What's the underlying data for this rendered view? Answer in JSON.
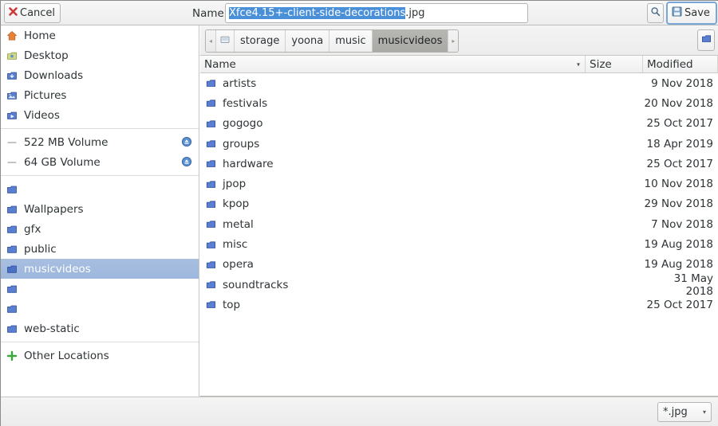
{
  "dialog": {
    "cancel_label": "Cancel",
    "save_label": "Save",
    "name_label": "Name",
    "filename_selected": "Xfce4.15+-client-side-decorations",
    "filename_extension": ".jpg",
    "filename_full": "Xfce4.15+-client-side-decorations.jpg",
    "search_icon": "search-icon",
    "cancel_icon": "cancel-x-icon",
    "save_icon": "floppy-disk-icon",
    "new_folder_icon": "new-folder-icon",
    "accent_selection": "#4a90d9",
    "accent_row_selected": "#a0b8e0"
  },
  "sidebar": {
    "groups": [
      {
        "items": [
          {
            "label": "Home",
            "icon": "home-icon",
            "selected": false
          },
          {
            "label": "Desktop",
            "icon": "desktop-icon",
            "selected": false
          },
          {
            "label": "Downloads",
            "icon": "downloads-icon",
            "selected": false
          },
          {
            "label": "Pictures",
            "icon": "pictures-icon",
            "selected": false
          },
          {
            "label": "Videos",
            "icon": "videos-icon",
            "selected": false
          }
        ]
      },
      {
        "items": [
          {
            "label": "522 MB Volume",
            "icon": "drive-icon",
            "eject": true,
            "selected": false
          },
          {
            "label": "64 GB Volume",
            "icon": "drive-icon",
            "eject": true,
            "selected": false
          }
        ]
      },
      {
        "items": [
          {
            "label": "",
            "icon": "bookmark-folder-icon",
            "selected": false
          },
          {
            "label": "Wallpapers",
            "icon": "bookmark-folder-icon",
            "selected": false
          },
          {
            "label": "gfx",
            "icon": "bookmark-folder-icon",
            "selected": false
          },
          {
            "label": "public",
            "icon": "bookmark-folder-icon",
            "selected": false
          },
          {
            "label": "musicvideos",
            "icon": "bookmark-folder-icon",
            "selected": true
          },
          {
            "label": "",
            "icon": "bookmark-folder-icon",
            "selected": false
          },
          {
            "label": "",
            "icon": "bookmark-folder-icon",
            "selected": false
          },
          {
            "label": "web-static",
            "icon": "bookmark-folder-icon",
            "selected": false
          }
        ]
      },
      {
        "items": [
          {
            "label": "Other Locations",
            "icon": "other-locations-icon",
            "selected": false
          }
        ]
      }
    ]
  },
  "pathbar": {
    "prev_arrow": "◂",
    "next_arrow": "▸",
    "root_icon": "drive-root-icon",
    "crumbs": [
      {
        "label": "storage",
        "active": false
      },
      {
        "label": "yoona",
        "active": false
      },
      {
        "label": "music",
        "active": false
      },
      {
        "label": "musicvideos",
        "active": true
      }
    ]
  },
  "filelist": {
    "columns": [
      "Name",
      "Size",
      "Modified"
    ],
    "sort_indicator": "▾",
    "rows": [
      {
        "name": "artists",
        "size": "",
        "modified": "9 Nov 2018",
        "icon": "folder-icon"
      },
      {
        "name": "festivals",
        "size": "",
        "modified": "20 Nov 2018",
        "icon": "folder-icon"
      },
      {
        "name": "gogogo",
        "size": "",
        "modified": "25 Oct 2017",
        "icon": "folder-icon"
      },
      {
        "name": "groups",
        "size": "",
        "modified": "18 Apr 2019",
        "icon": "folder-icon"
      },
      {
        "name": "hardware",
        "size": "",
        "modified": "25 Oct 2017",
        "icon": "folder-icon"
      },
      {
        "name": "jpop",
        "size": "",
        "modified": "10 Nov 2018",
        "icon": "folder-icon"
      },
      {
        "name": "kpop",
        "size": "",
        "modified": "29 Nov 2018",
        "icon": "folder-icon"
      },
      {
        "name": "metal",
        "size": "",
        "modified": "7 Nov 2018",
        "icon": "folder-icon"
      },
      {
        "name": "misc",
        "size": "",
        "modified": "19 Aug 2018",
        "icon": "folder-icon"
      },
      {
        "name": "opera",
        "size": "",
        "modified": "19 Aug 2018",
        "icon": "folder-icon"
      },
      {
        "name": "soundtracks",
        "size": "",
        "modified": "31 May 2018",
        "icon": "folder-icon"
      },
      {
        "name": "top",
        "size": "",
        "modified": "25 Oct 2017",
        "icon": "folder-icon"
      }
    ]
  },
  "bottom": {
    "filter_value": "*.jpg",
    "filter_arrow": "▾"
  }
}
